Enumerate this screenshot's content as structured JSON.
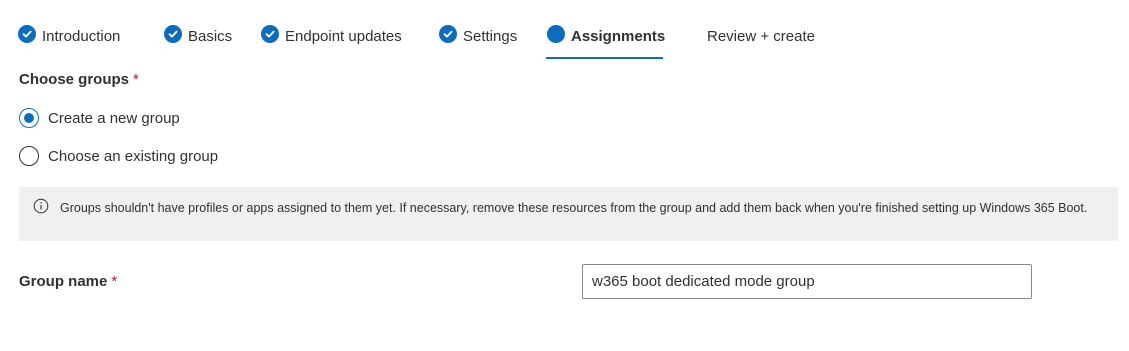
{
  "wizard": {
    "tabs": [
      {
        "label": "Introduction",
        "state": "completed",
        "icon": "checkmark-circle-icon"
      },
      {
        "label": "Basics",
        "state": "completed",
        "icon": "checkmark-circle-icon"
      },
      {
        "label": "Endpoint updates",
        "state": "completed",
        "icon": "checkmark-circle-icon"
      },
      {
        "label": "Settings",
        "state": "completed",
        "icon": "checkmark-circle-icon"
      },
      {
        "label": "Assignments",
        "state": "current",
        "icon": "current-step-dot-icon"
      },
      {
        "label": "Review + create",
        "state": "pending",
        "icon": ""
      }
    ]
  },
  "choose_groups": {
    "label": "Choose groups",
    "required_marker": "*",
    "options": [
      {
        "label": "Create a new group",
        "checked": true
      },
      {
        "label": "Choose an existing group",
        "checked": false
      }
    ]
  },
  "info_banner": {
    "icon": "info-icon",
    "text": "Groups shouldn't have profiles or apps assigned to them yet. If necessary, remove these resources from the group and add them back when you're finished setting up Windows 365 Boot."
  },
  "group_name": {
    "label": "Group name",
    "required_marker": "*",
    "value": "w365 boot dedicated mode group"
  },
  "colors": {
    "accent": "#0f6cbd",
    "required": "#a4262c",
    "banner_bg": "#f0f0f0",
    "text": "#323130"
  }
}
